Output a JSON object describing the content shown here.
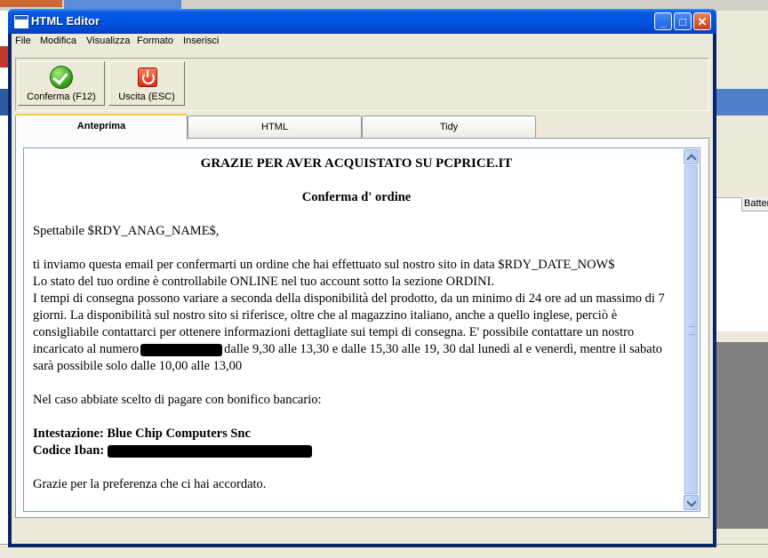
{
  "background": {
    "right_column_header": "Batter"
  },
  "window": {
    "title": "HTML Editor",
    "minimize_glyph": "_",
    "maximize_glyph": "□",
    "close_glyph": "✕"
  },
  "menu": {
    "items": [
      "File",
      "Modifica",
      "Visualizza",
      "Formato",
      "Inserisci"
    ]
  },
  "toolbar": {
    "confirm_label": "Conferma (F12)",
    "exit_label": "Uscita (ESC)"
  },
  "tabs": [
    {
      "label": "Anteprima",
      "active": true
    },
    {
      "label": "HTML",
      "active": false
    },
    {
      "label": "Tidy",
      "active": false
    }
  ],
  "document": {
    "title": "GRAZIE PER AVER ACQUISTATO SU PCPRICE.IT",
    "subtitle": "Conferma d' ordine",
    "greeting": "Spettabile $RDY_ANAG_NAME$,",
    "p1_line1": "ti inviamo questa email per confermarti un ordine che hai effettuato sul nostro sito in data $RDY_DATE_NOW$",
    "p1_line2": "Lo stato del tuo ordine è controllabile ONLINE nel tuo account sotto la sezione ORDINI.",
    "p1_line3": "I tempi di consegna possono variare a seconda della disponibilità del prodotto, da un minimo di 24 ore ad un massimo di 7 giorni. La disponibilità sul nostro sito si riferisce, oltre che al magazzino italiano, anche a quello inglese, perciò è consigliabile contattarci per ottenere informazioni dettagliate sui tempi di consegna. E' possibile contattare un nostro incaricato al numero",
    "p1_line3_tail": "dalle 9,30 alle 13,30 e dalle 15,30 alle 19, 30 dal lunedì al e venerdì, mentre il sabato sarà possibile solo dalle 10,00 alle 13,00",
    "bonifico": "Nel caso abbiate scelto di pagare con bonifico bancario:",
    "intestazione": "Intestazione: Blue Chip Computers Snc",
    "iban_label": "Codice Iban:",
    "closing": "Grazie per la preferenza che ci hai accordato."
  }
}
